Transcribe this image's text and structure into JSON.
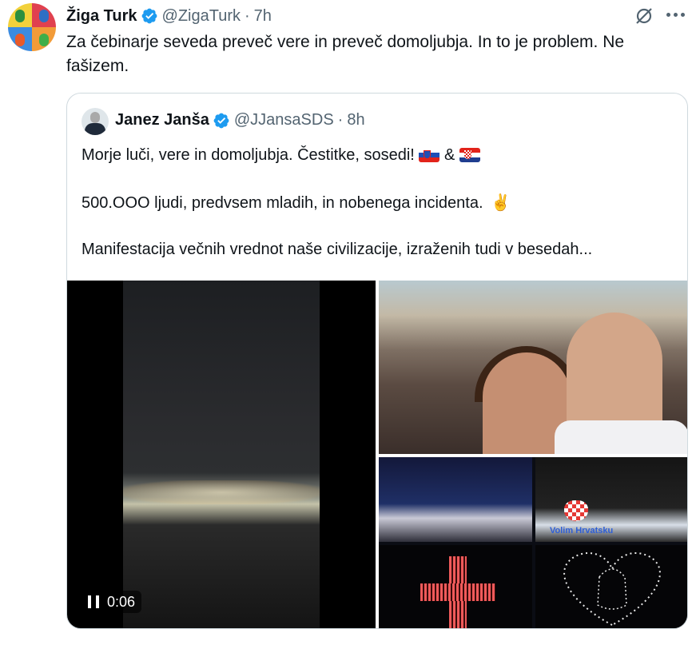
{
  "tweet": {
    "author_name": "Žiga Turk",
    "author_handle": "@ZigaTurk",
    "separator": "·",
    "time": "7h",
    "text": "Za čebinarje seveda preveč vere in preveč domoljubja. In to je problem. Ne fašizem."
  },
  "quoted_tweet": {
    "author_name": "Janez Janša",
    "author_handle": "@JJansaSDS",
    "separator": "·",
    "time": "8h",
    "line1": "Morje luči, vere in domoljubja. Čestitke, sosedi! ",
    "line1_amp": " & ",
    "line2": "500.OOO ljudi, predvsem mladih, in nobenega incidenta. ",
    "line2_emoji": "✌️",
    "line3": "Manifestacija večnih vrednot naše civilizacije, izraženih tudi v besedah...",
    "video_time": "0:06",
    "collage_label": "Volim Hrvatsku"
  },
  "colors": {
    "verified_blue": "#1d9bf0",
    "text_primary": "#0f1419",
    "text_secondary": "#536471",
    "border": "#cfd9de"
  },
  "icons": [
    "verified-badge-icon",
    "grok-icon",
    "more-icon",
    "slovenia-flag-icon",
    "croatia-flag-icon",
    "pause-icon"
  ]
}
